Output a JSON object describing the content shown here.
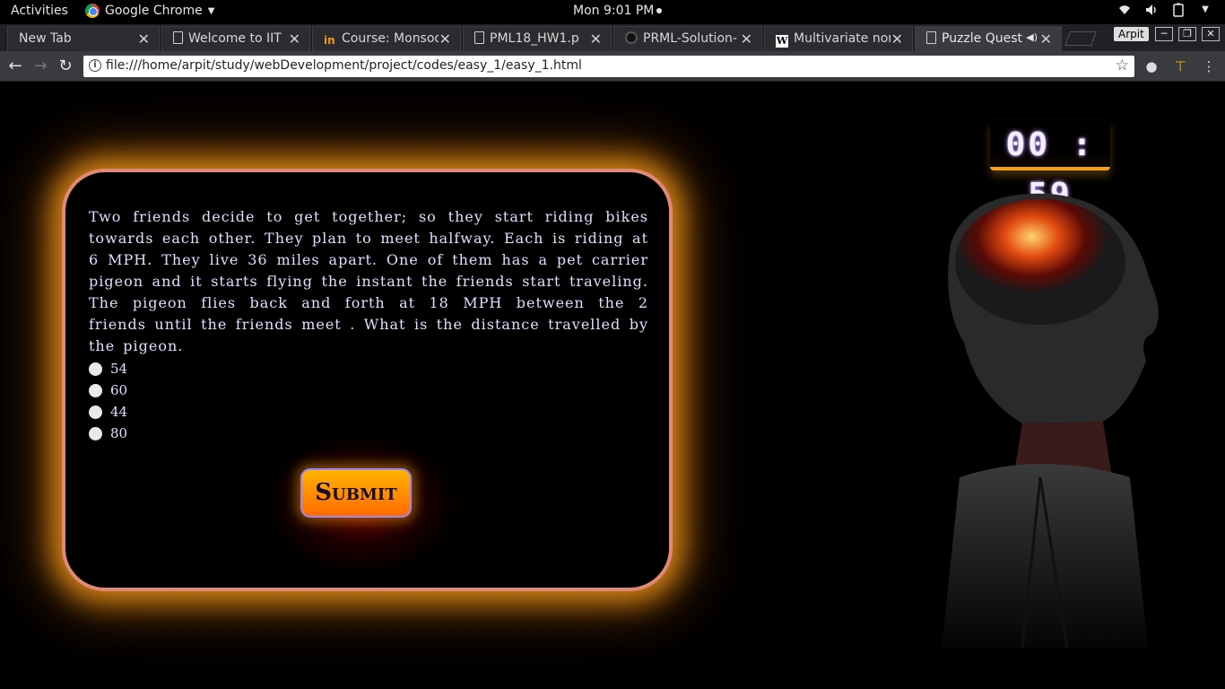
{
  "topbar": {
    "activities": "Activities",
    "app_name": "Google Chrome",
    "clock": "Mon  9:01 PM"
  },
  "tabs": [
    {
      "title": "New Tab",
      "icon": "none"
    },
    {
      "title": "Welcome to IIT",
      "icon": "document-icon"
    },
    {
      "title": "Course: Monsoo",
      "icon": "in-icon"
    },
    {
      "title": "PML18_HW1.p",
      "icon": "document-icon"
    },
    {
      "title": "PRML-Solution-",
      "icon": "github-icon"
    },
    {
      "title": "Multivariate nor",
      "icon": "wikipedia-icon"
    },
    {
      "title": "Puzzle Quest",
      "icon": "document-icon",
      "active": true
    }
  ],
  "user_badge": "Arpit",
  "address_bar": {
    "url": "file:///home/arpit/study/webDevelopment/project/codes/easy_1/easy_1.html"
  },
  "timer": "00 : 59",
  "quiz": {
    "question": "Two friends decide to get together; so they start riding bikes towards each other. They plan to meet halfway. Each is riding at 6 MPH. They live 36 miles apart. One of them has a pet carrier pigeon and it starts flying the instant the friends start traveling. The pigeon flies back and forth at 18 MPH between the 2 friends until the friends meet . What is the distance travelled by the pigeon.",
    "options": [
      "54",
      "60",
      "44",
      "80"
    ],
    "submit_label": "Submit"
  },
  "colors": {
    "card_border": "#e18878",
    "card_glow": "#ffa51e",
    "text": "#e4dcff",
    "button_top": "#ffb400",
    "button_bottom": "#ff6a00",
    "timer_underline": "#f0a020"
  }
}
